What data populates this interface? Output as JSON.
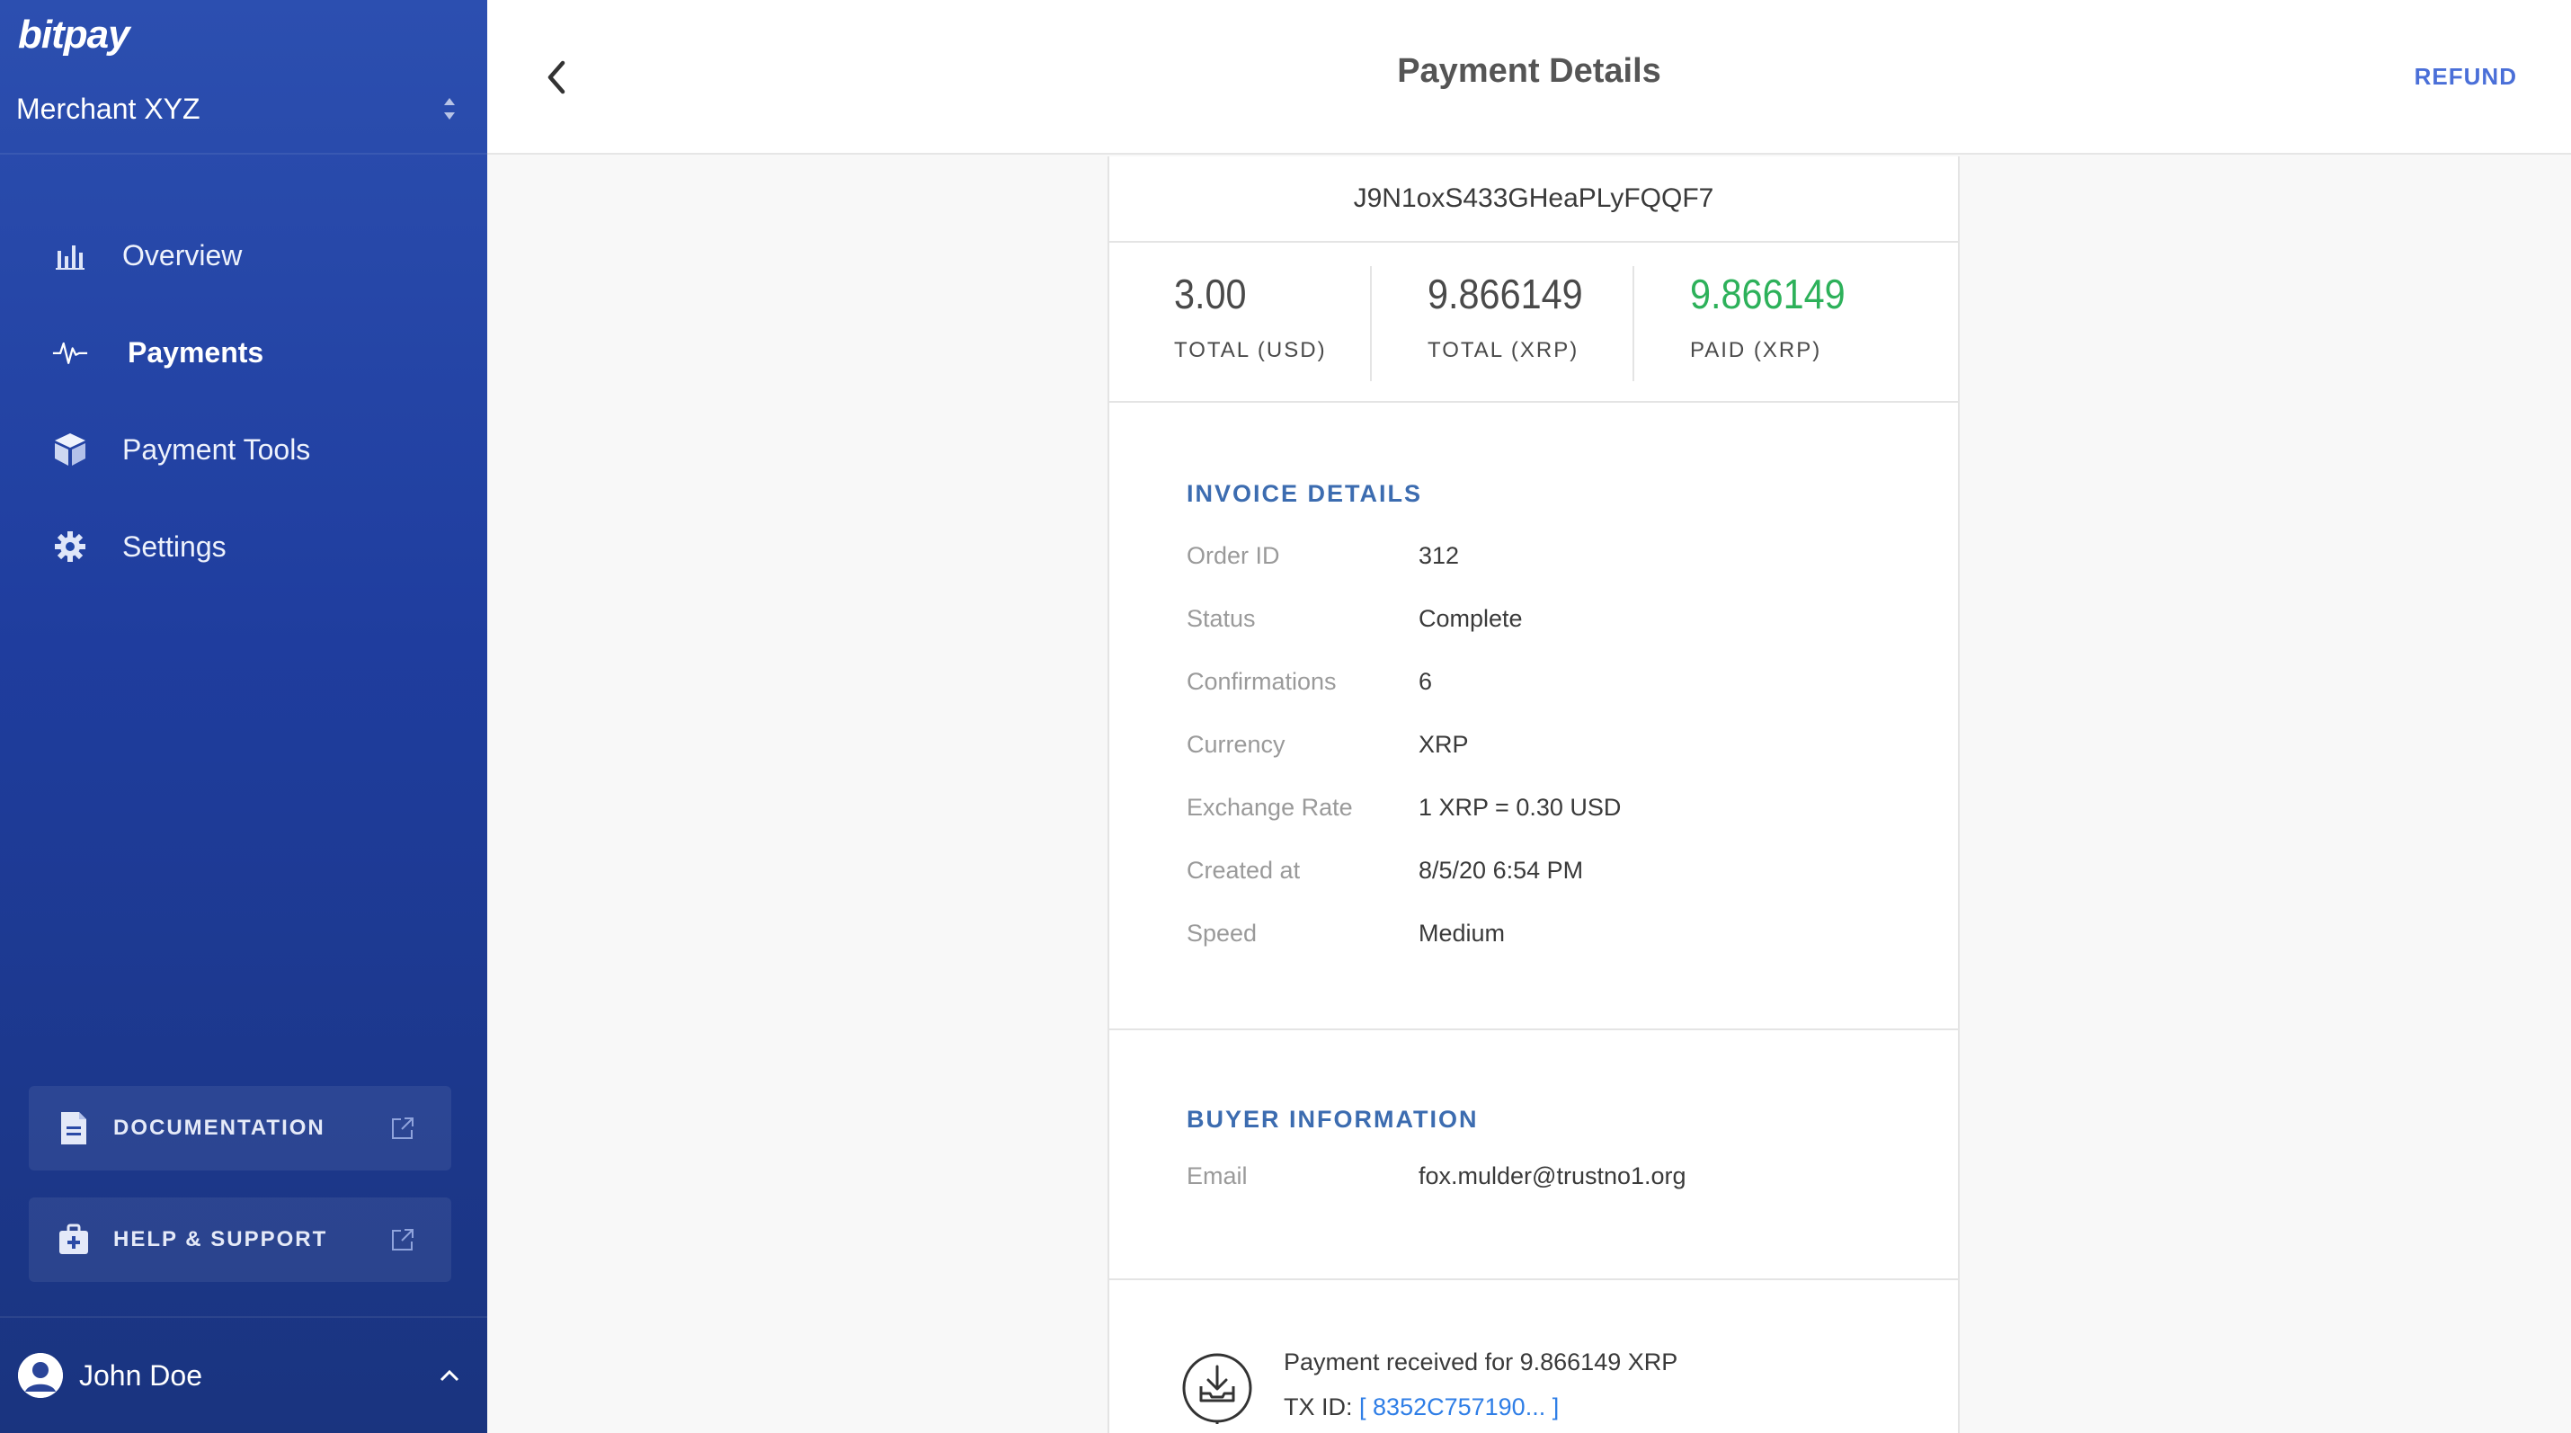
{
  "sidebar": {
    "brand": "bitpay",
    "merchant": "Merchant XYZ",
    "nav": [
      {
        "label": "Overview",
        "icon": "bar-chart-icon"
      },
      {
        "label": "Payments",
        "icon": "pulse-icon",
        "active": true
      },
      {
        "label": "Payment Tools",
        "icon": "cube-icon"
      },
      {
        "label": "Settings",
        "icon": "gear-icon"
      }
    ],
    "documentation": "DOCUMENTATION",
    "help": "HELP & SUPPORT",
    "user": "John Doe"
  },
  "header": {
    "title": "Payment Details",
    "refund": "REFUND"
  },
  "invoice": {
    "id": "J9N1oxS433GHeaPLyFQQF7",
    "totals": [
      {
        "value": "3.00",
        "label": "TOTAL (USD)"
      },
      {
        "value": "9.866149",
        "label": "TOTAL (XRP)"
      },
      {
        "value": "9.866149",
        "label": "PAID (XRP)"
      }
    ]
  },
  "invoice_details": {
    "title": "INVOICE DETAILS",
    "rows": [
      {
        "key": "Order ID",
        "value": "312"
      },
      {
        "key": "Status",
        "value": "Complete"
      },
      {
        "key": "Confirmations",
        "value": "6"
      },
      {
        "key": "Currency",
        "value": "XRP"
      },
      {
        "key": "Exchange Rate",
        "value": "1 XRP = 0.30 USD"
      },
      {
        "key": "Created at",
        "value": "8/5/20 6:54 PM"
      },
      {
        "key": "Speed",
        "value": "Medium"
      }
    ]
  },
  "buyer": {
    "title": "BUYER INFORMATION",
    "rows": [
      {
        "key": "Email",
        "value": "fox.mulder@trustno1.org"
      }
    ]
  },
  "activity": {
    "message": "Payment received for 9.866149 XRP",
    "tx_label": "TX ID:",
    "tx_id": "[ 8352C757190... ]"
  },
  "colors": {
    "sidebar": "#2247a8",
    "accent": "#4a6fd8",
    "section_title": "#3c6cb0",
    "paid": "#2db15a",
    "link": "#2f7ee6"
  }
}
